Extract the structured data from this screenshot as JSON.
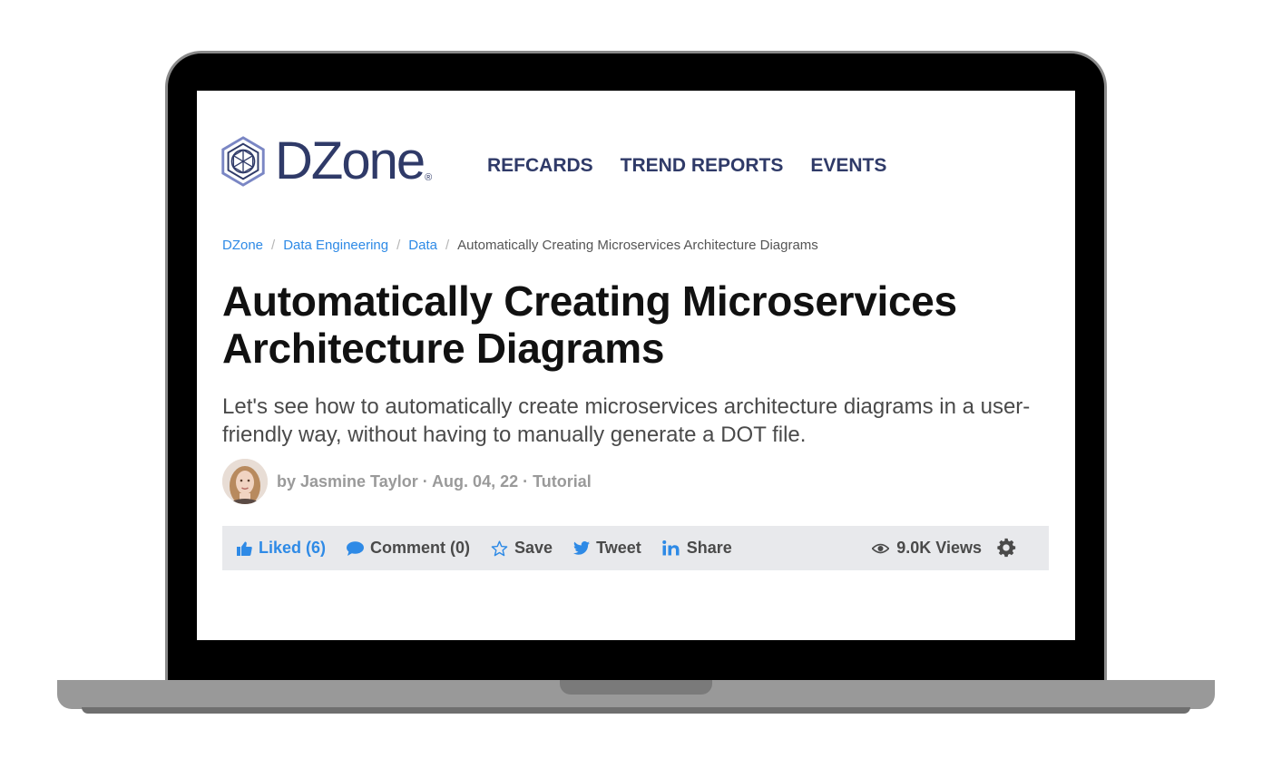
{
  "header": {
    "logo_text": "DZone",
    "logo_reg": "®",
    "nav": [
      "REFCARDS",
      "TREND REPORTS",
      "EVENTS"
    ]
  },
  "breadcrumb": {
    "items": [
      "DZone",
      "Data Engineering",
      "Data"
    ],
    "separator": "/",
    "current": "Automatically Creating Microservices Architecture Diagrams"
  },
  "article": {
    "title_line1": "Automatically Creating Microservices",
    "title_line2": "Architecture Diagrams",
    "subtitle": "Let's see how to automatically create microservices architecture diagrams in a user-friendly way, without having to manually generate a DOT file.",
    "byline": "by Jasmine Taylor · Aug. 04, 22 · Tutorial"
  },
  "actions": {
    "liked": "Liked (6)",
    "comment": "Comment (0)",
    "save": "Save",
    "tweet": "Tweet",
    "share": "Share",
    "views": "9.0K Views"
  },
  "colors": {
    "brand_navy": "#2f3a68",
    "link_blue": "#2e8ae6",
    "action_bar_bg": "#e8e9ec"
  },
  "icons": [
    "dzone-logo-icon",
    "thumbs-up-icon",
    "comment-bubble-icon",
    "star-outline-icon",
    "twitter-bird-icon",
    "linkedin-icon",
    "eye-icon",
    "gear-icon"
  ]
}
